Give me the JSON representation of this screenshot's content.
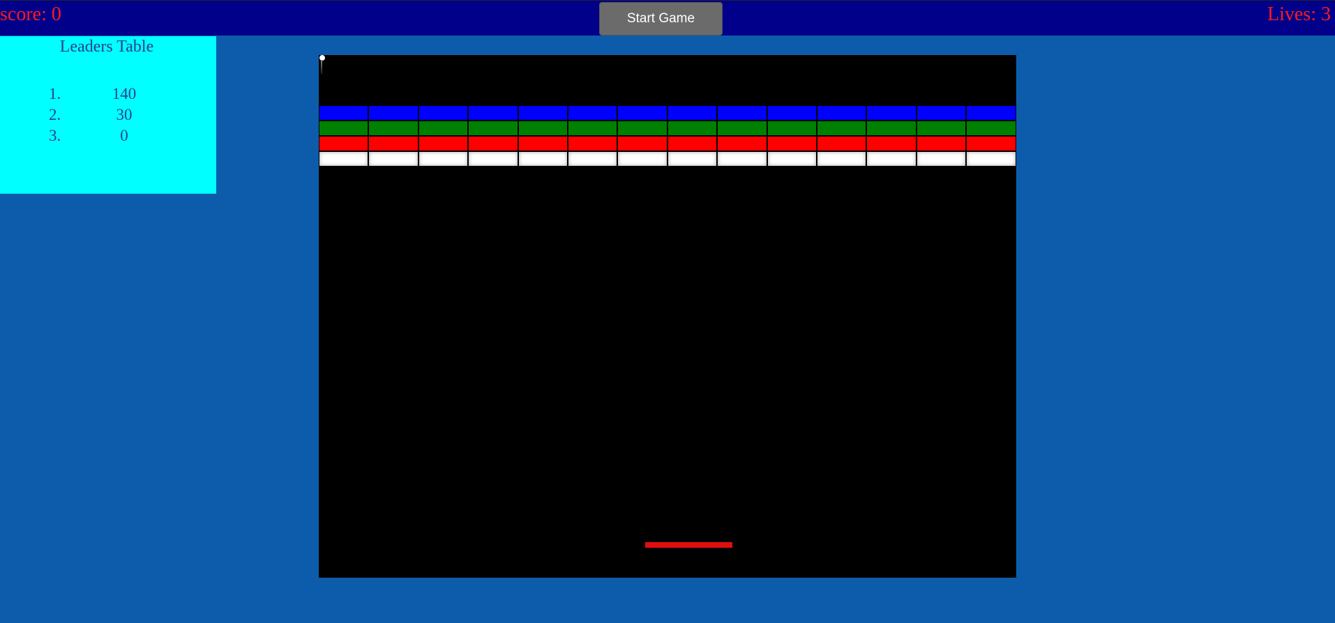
{
  "header": {
    "score_text": "score: 0",
    "lives_text": "Lives: 3",
    "start_button_label": "Start Game"
  },
  "leaders": {
    "title": "Leaders Table",
    "entries": [
      {
        "rank": "1.",
        "score": "140"
      },
      {
        "rank": "2.",
        "score": "30"
      },
      {
        "rank": "3.",
        "score": "0"
      }
    ]
  },
  "game": {
    "brick_columns": 14,
    "brick_rows": [
      {
        "color": "#0000ff"
      },
      {
        "color": "#008000"
      },
      {
        "color": "#ff0000"
      },
      {
        "color": "#ffffff"
      }
    ],
    "paddle_color": "#e10e0e",
    "ball_color": "#ffffff",
    "field_color": "#000000"
  },
  "colors": {
    "page_background": "#0d5cab",
    "header_background": "#00008b",
    "leaders_background": "#00ffff",
    "hud_text": "#ff1a1a"
  }
}
